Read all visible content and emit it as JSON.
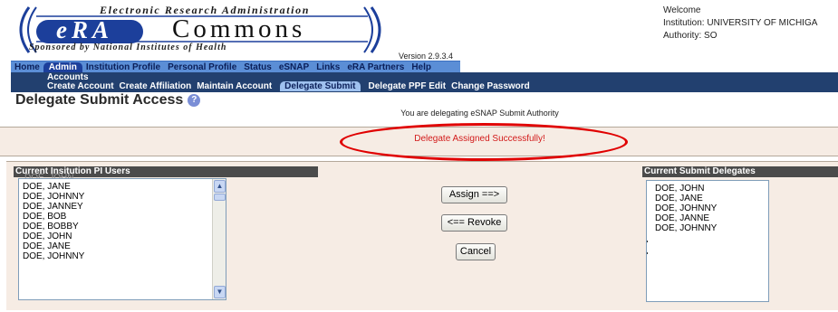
{
  "header": {
    "logo_top_text": "Electronic Research Administration",
    "logo_era": "eRA",
    "logo_commons": "Commons",
    "logo_sponsor": "Sponsored by National Institutes of Health",
    "version": "Version 2.9.3.4",
    "welcome": "Welcome",
    "institution": "Institution: UNIVERSITY OF MICHIGA",
    "authority": "Authority:  SO"
  },
  "main_nav": {
    "items": [
      "Home",
      "Admin",
      "Institution Profile",
      "Personal Profile",
      "Status",
      "eSNAP",
      "Links",
      "eRA Partners",
      "Help"
    ],
    "active": "Admin"
  },
  "sub_nav": {
    "section_label": "Accounts",
    "items": [
      "Create Account",
      "Create Affiliation",
      "Maintain Account",
      "Delegate Submit",
      "Delegate PPF Edit",
      "Change Password"
    ],
    "active": "Delegate Submit"
  },
  "page": {
    "title": "Delegate Submit Access",
    "delegating_text": "You are delegating eSNAP Submit Authority",
    "success_message": "Delegate Assigned Successfully!"
  },
  "left_panel": {
    "header": "Current Insitution PI Users",
    "ghost_item": "DOE, JOHN",
    "items": [
      "DOE, JANE",
      "DOE, JOHNNY",
      "DOE, JANNEY",
      "DOE, BOB",
      "DOE, BOBBY",
      "DOE, JOHN",
      "DOE, JANE",
      "DOE, JOHNNY"
    ]
  },
  "right_panel": {
    "header": "Current Submit Delegates",
    "items": [
      "DOE, JOHN",
      "DOE, JANE",
      "DOE, JOHNNY",
      "DOE, JANNE",
      "DOE, JOHNNY"
    ]
  },
  "buttons": {
    "assign": "Assign ==>",
    "revoke": "<== Revoke",
    "cancel": "Cancel"
  },
  "colors": {
    "nav_blue": "#5b8ed6",
    "subnav_navy": "#22406f",
    "success_red": "#d21a1a",
    "highlight_ellipse": "#e00000",
    "panel_bg": "#f6ece4"
  }
}
